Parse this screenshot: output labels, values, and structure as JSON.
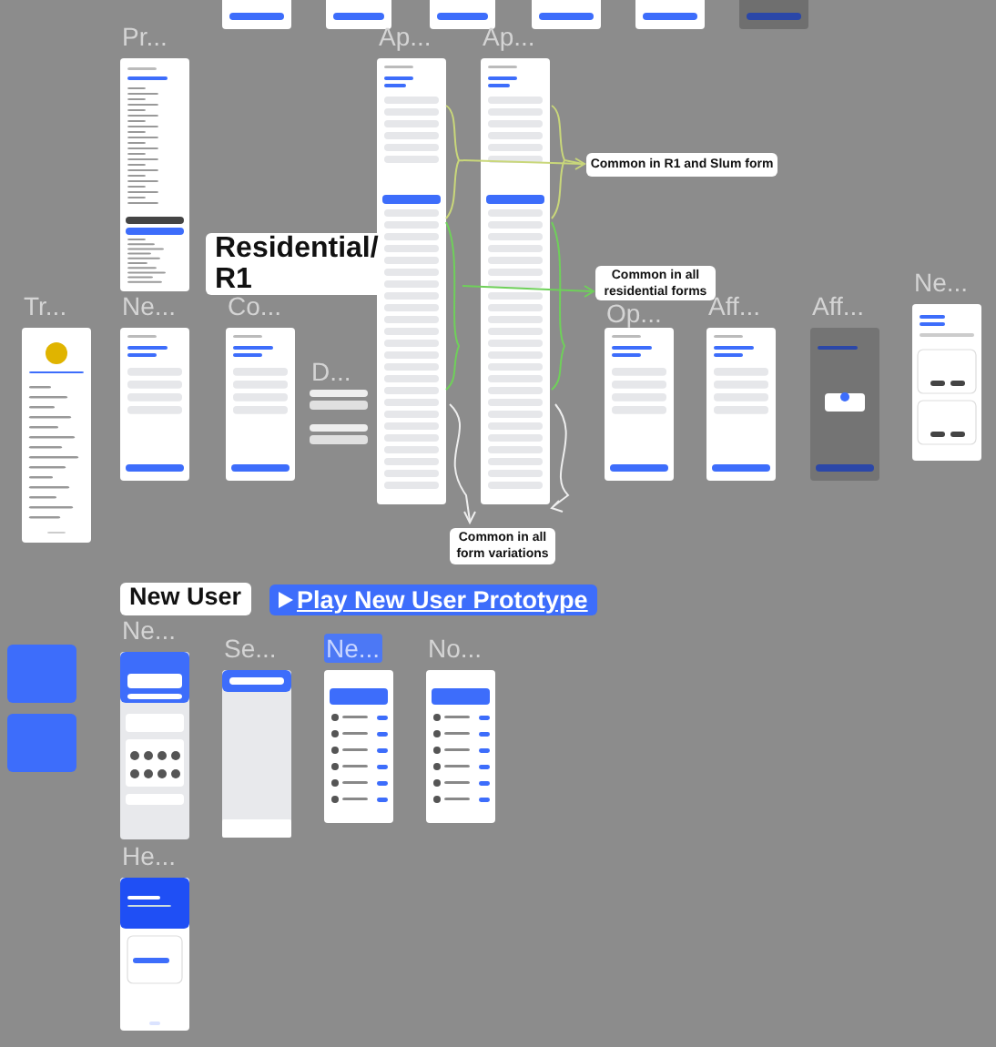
{
  "canvas": {
    "frames": [
      {
        "kind": "partial"
      },
      {
        "kind": "partial"
      },
      {
        "kind": "partial"
      },
      {
        "kind": "partial"
      },
      {
        "kind": "partial"
      },
      {
        "kind": "partial-dimmed"
      },
      {
        "label": "Pr...",
        "kind": "preview",
        "selected": false
      },
      {
        "label": "Ap...",
        "kind": "long-form",
        "selected": false
      },
      {
        "label": "Ap...",
        "kind": "long-form",
        "selected": false
      },
      {
        "label": "Tr...",
        "kind": "tracker",
        "selected": false
      },
      {
        "label": "Ne...",
        "kind": "form",
        "selected": false
      },
      {
        "label": "Co...",
        "kind": "form",
        "selected": false
      },
      {
        "label": "D...",
        "kind": "components",
        "selected": false
      },
      {
        "label": "Op...",
        "kind": "form",
        "selected": false
      },
      {
        "label": "Aff...",
        "kind": "form",
        "selected": false
      },
      {
        "label": "Aff...",
        "kind": "dimmed",
        "selected": false
      },
      {
        "label": "Ne...",
        "kind": "cards",
        "selected": false
      },
      {
        "label": "Ne...",
        "kind": "home",
        "selected": false
      },
      {
        "label": "Se...",
        "kind": "search",
        "selected": false
      },
      {
        "label": "Ne...",
        "kind": "list",
        "selected": true
      },
      {
        "label": "No...",
        "kind": "list",
        "selected": false
      },
      {
        "label": "He...",
        "kind": "hero",
        "selected": false
      }
    ],
    "notes": [
      {
        "text": "Common in R1 and Slum form"
      },
      {
        "text": "Common in all residential forms"
      },
      {
        "text": "Common in all form variations"
      }
    ],
    "section_labels": [
      {
        "text": "Residential/ R1"
      },
      {
        "text": "New User"
      }
    ],
    "prototype_button": {
      "label": "Play New User Prototype"
    }
  }
}
